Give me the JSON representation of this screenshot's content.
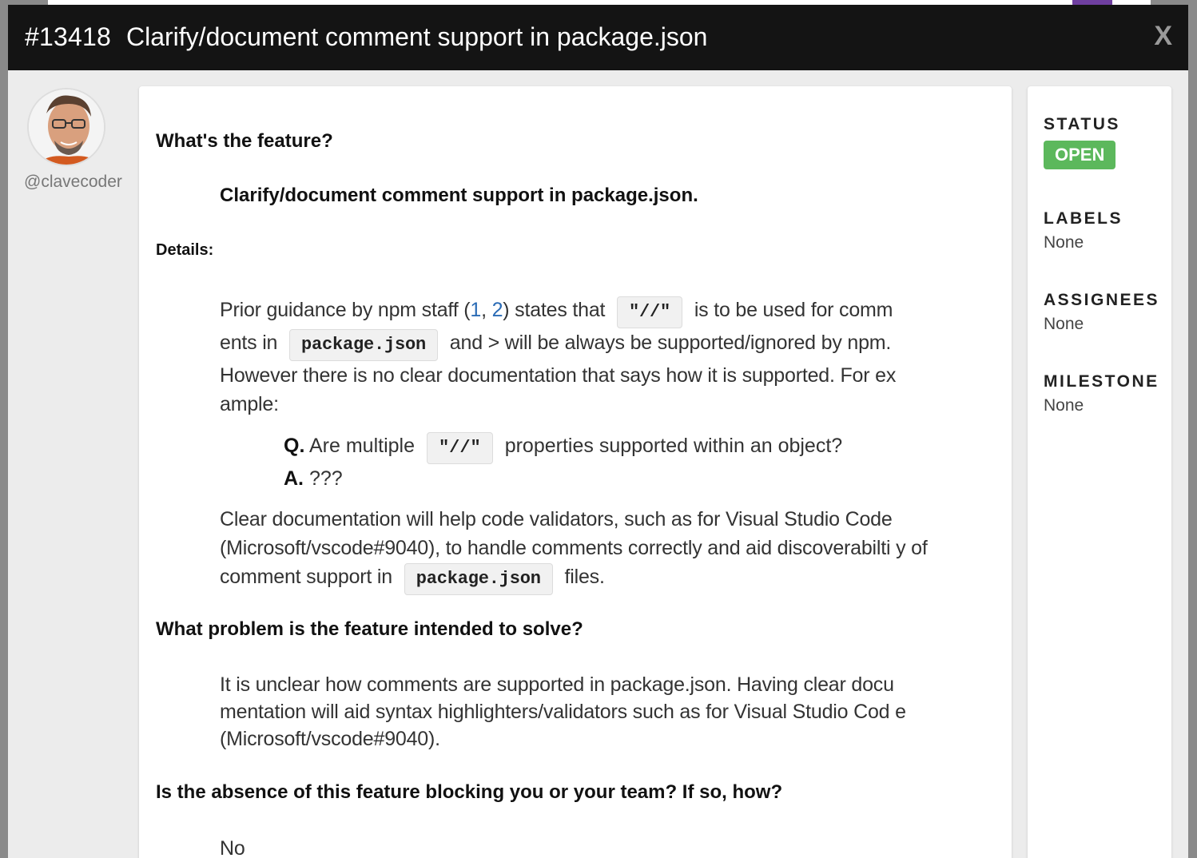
{
  "modal": {
    "issue_number": "#13418",
    "title": "Clarify/document comment support in package.json",
    "close_label": "X"
  },
  "author": {
    "username": "@clavecoder"
  },
  "body": {
    "h_feature": "What's the feature?",
    "feature_name": "Clarify/document comment support in package.json.",
    "details_label": "Details:",
    "p1_a": "Prior guidance by npm staff (",
    "p1_link1": "1",
    "p1_sep": ", ",
    "p1_link2": "2",
    "p1_b": ") states that",
    "p1_code1": "\"//\"",
    "p1_c": "is to be used for comm ents in",
    "p1_code2": "package.json",
    "p1_d": "and > will be always be supported/ignored by npm. However there is no clear documentation that says how it is supported. For ex ample:",
    "q_label": "Q.",
    "q_text_a": "Are multiple",
    "q_code": "\"//\"",
    "q_text_b": "properties supported within an object?",
    "a_label": "A.",
    "a_text": "???",
    "p2_a": "Clear documentation will help code validators, such as for Visual Studio Code (Microsoft/vscode#9040), to handle comments correctly and aid discoverabilti y of comment support in",
    "p2_code": "package.json",
    "p2_b": "files.",
    "h_problem": "What problem is the feature intended to solve?",
    "p3": "It is unclear how comments are supported in package.json. Having clear docu mentation will aid syntax highlighters/validators such as for Visual Studio Cod e (Microsoft/vscode#9040).",
    "h_blocking": "Is the absence of this feature blocking you or your team? If so, how?",
    "p4": "No"
  },
  "sidebar": {
    "status_label": "STATUS",
    "status_value": "OPEN",
    "labels_label": "LABELS",
    "labels_value": "None",
    "assignees_label": "ASSIGNEES",
    "assignees_value": "None",
    "milestone_label": "MILESTONE",
    "milestone_value": "None"
  },
  "colors": {
    "header_bg": "#141414",
    "status_open": "#5cb85c",
    "link": "#2a6bb5"
  }
}
